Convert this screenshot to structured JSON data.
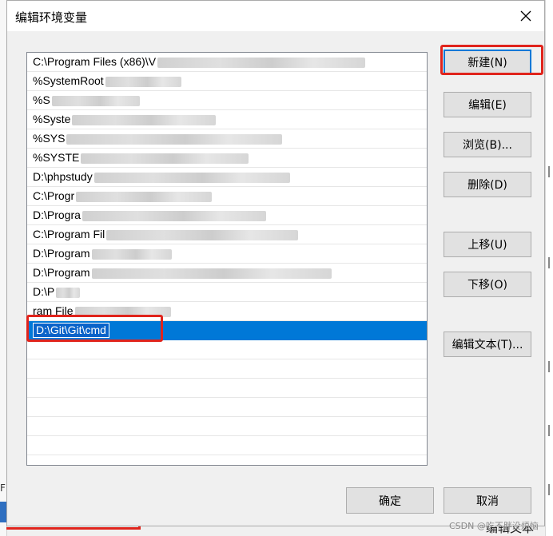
{
  "dialog": {
    "title": "编辑环境变量",
    "close_icon": "close-icon"
  },
  "paths": [
    {
      "text": "C:\\Program Files (x86)\\V",
      "redacted": true
    },
    {
      "text": "%SystemRoot",
      "redacted": true
    },
    {
      "text": "%S",
      "redacted": true
    },
    {
      "text": "%Syste",
      "redacted": true
    },
    {
      "text": "%SYS",
      "redacted": true
    },
    {
      "text": "%SYSTE",
      "redacted": true
    },
    {
      "text": "D:\\phpstudy",
      "redacted": true
    },
    {
      "text": "C:\\Progr",
      "redacted": true
    },
    {
      "text": "D:\\Progra",
      "redacted": true
    },
    {
      "text": "C:\\Program Fil",
      "redacted": true
    },
    {
      "text": "D:\\Program",
      "redacted": true
    },
    {
      "text": "D:\\Program",
      "redacted": true
    },
    {
      "text": "D:\\P",
      "redacted": true
    },
    {
      "text": "ram File",
      "redacted": true
    },
    {
      "text": "D:\\Git\\Git\\cmd",
      "redacted": false,
      "selected": true
    }
  ],
  "buttons": {
    "new": "新建(N)",
    "edit": "编辑(E)",
    "browse": "浏览(B)...",
    "delete": "删除(D)",
    "move_up": "上移(U)",
    "move_down": "下移(O)",
    "edit_text": "编辑文本(T)...",
    "ok": "确定",
    "cancel": "取消"
  },
  "colors": {
    "selection": "#0078d7",
    "annotation": "#e0241c",
    "dialog_bg": "#f0f0f0"
  },
  "watermark": "CSDN @吃不胖没烦恼",
  "background_fragments": {
    "left": "F",
    "bottom": "编辑文本"
  }
}
